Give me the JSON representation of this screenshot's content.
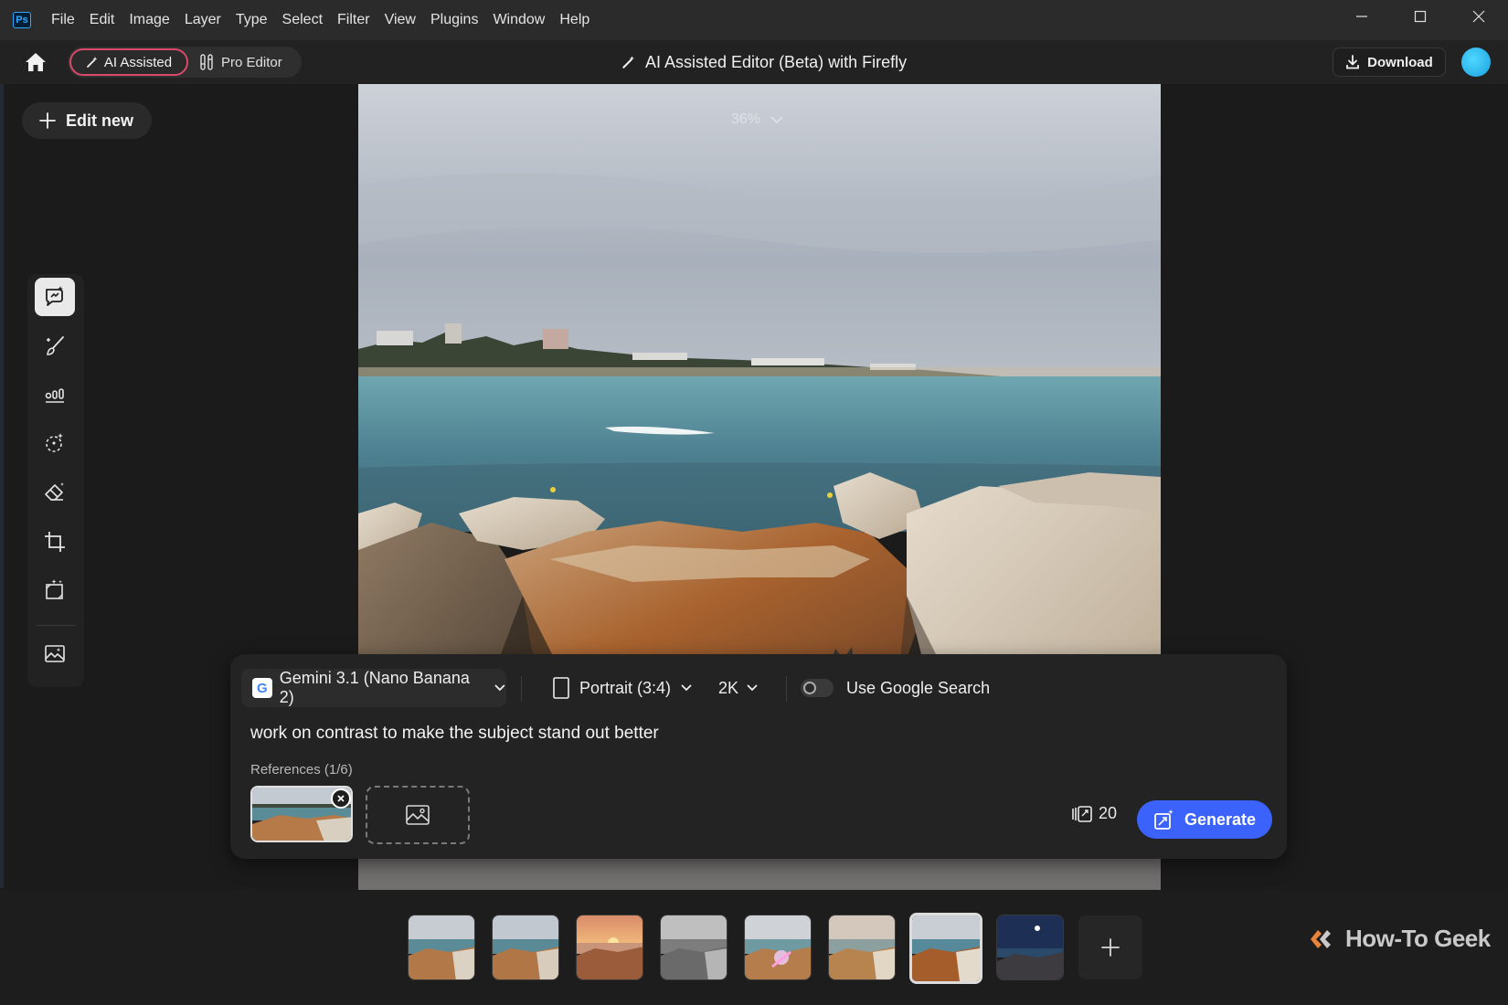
{
  "titlebar": {
    "menu": [
      "File",
      "Edit",
      "Image",
      "Layer",
      "Type",
      "Select",
      "Filter",
      "View",
      "Plugins",
      "Window",
      "Help"
    ],
    "app_icon_text": "Ps"
  },
  "appbar": {
    "mode_ai": "AI Assisted",
    "mode_pro": "Pro Editor",
    "title": "AI Assisted Editor (Beta) with Firefly",
    "download": "Download"
  },
  "sidebar": {
    "edit_new": "Edit new"
  },
  "canvas": {
    "zoom": "36%"
  },
  "prompt": {
    "model": "Gemini 3.1 (Nano Banana 2)",
    "model_icon_text": "G",
    "aspect": "Portrait (3:4)",
    "resolution": "2K",
    "google_search": "Use Google Search",
    "text": "work on contrast to make the subject stand out better",
    "references_label": "References (1/6)",
    "credits": "20",
    "generate": "Generate"
  },
  "brand": {
    "name": "How-To Geek"
  },
  "colors": {
    "accent_generate": "#3b63fb",
    "ai_mode_border": "#d94a6a",
    "avatar": "#1aa0e0"
  }
}
